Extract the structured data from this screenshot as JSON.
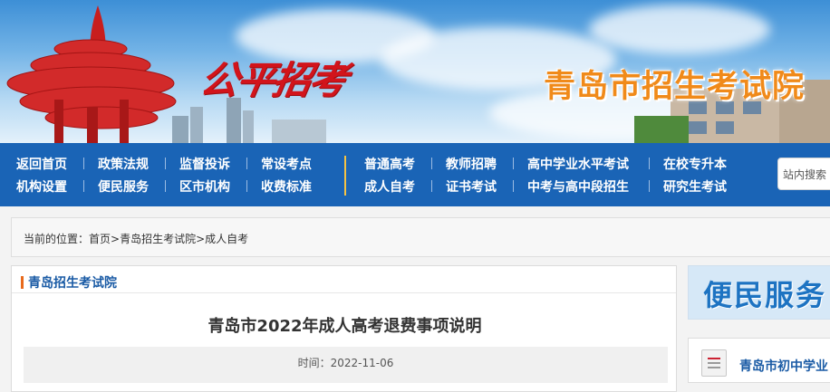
{
  "header": {
    "slogan": "公平招考",
    "site_title": "青岛市招生考试院"
  },
  "nav": {
    "left_row1": [
      "返回首页",
      "政策法规",
      "监督投诉",
      "常设考点"
    ],
    "left_row2": [
      "机构设置",
      "便民服务",
      "区市机构",
      "收费标准"
    ],
    "right_row1": [
      "普通高考",
      "教师招聘",
      "高中学业水平考试",
      "在校专升本"
    ],
    "right_row2": [
      "成人自考",
      "证书考试",
      "中考与高中段招生",
      "研究生考试"
    ],
    "search_placeholder": "站内搜索"
  },
  "breadcrumb": {
    "prefix": "当前的位置：",
    "home": "首页",
    "sep1": ">",
    "level1": "青岛招生考试院",
    "sep2": ">",
    "level2": "成人自考"
  },
  "article": {
    "section_label": "青岛招生考试院",
    "title": "青岛市2022年成人高考退费事项说明",
    "time": "时间：2022-11-06"
  },
  "sidebar": {
    "banner_title": "便民服务",
    "link1": "青岛市初中学业"
  },
  "colors": {
    "nav_bg": "#1a64b6",
    "site_title": "#f08a1a",
    "slogan": "#d2141b",
    "accent_bar": "#e86a1c"
  }
}
